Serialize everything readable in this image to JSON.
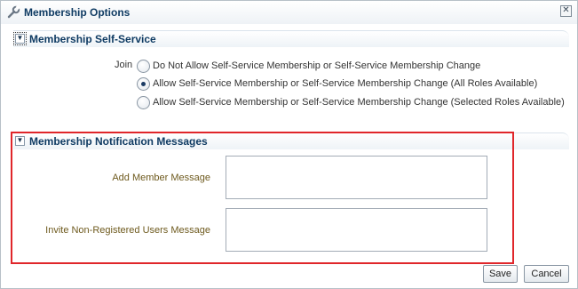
{
  "dialog": {
    "title": "Membership Options",
    "title_icon": "wrench-icon",
    "close_icon": "close-icon",
    "close_glyph": "✕"
  },
  "self_service": {
    "header": "Membership Self-Service",
    "expanded": true,
    "join_label": "Join",
    "options": [
      {
        "label": "Do Not Allow Self-Service Membership or Self-Service Membership Change",
        "selected": false
      },
      {
        "label": "Allow Self-Service Membership or Self-Service Membership Change (All Roles Available)",
        "selected": true
      },
      {
        "label": "Allow Self-Service Membership or Self-Service Membership Change (Selected Roles Available)",
        "selected": false
      }
    ]
  },
  "notifications": {
    "header": "Membership Notification Messages",
    "expanded": true,
    "add_member_label": "Add Member Message",
    "add_member_value": "",
    "invite_label": "Invite Non-Registered Users Message",
    "invite_value": ""
  },
  "buttons": {
    "save": "Save",
    "cancel": "Cancel"
  },
  "colors": {
    "highlight_frame": "#e0262a",
    "header_text": "#0f3b63",
    "field_label_text": "#6e5a1e"
  }
}
